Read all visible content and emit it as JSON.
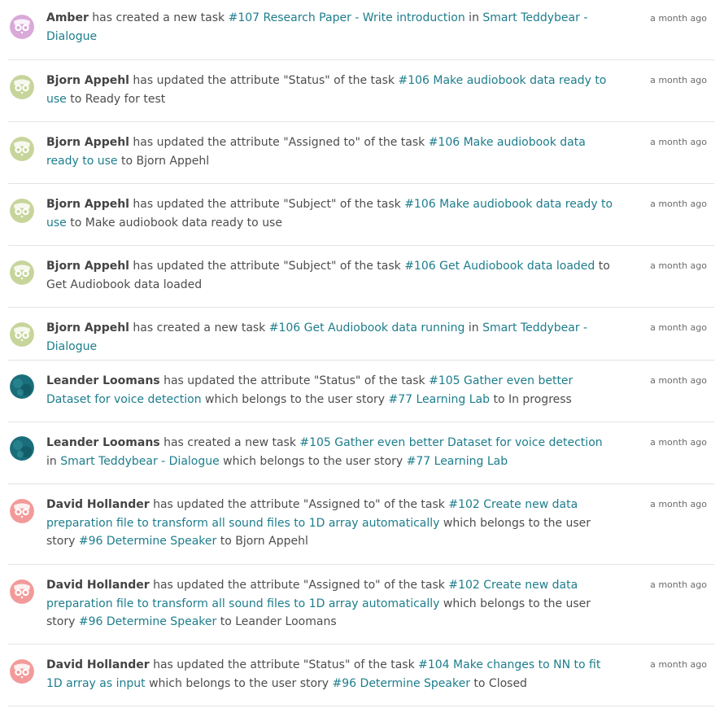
{
  "colors": {
    "link": "#1d7d8c",
    "avatar_amber": "#d9a9d9",
    "avatar_bjorn": "#c7d59b",
    "avatar_leander": "#1a6e7c",
    "avatar_david": "#f29a9a"
  },
  "activities": [
    {
      "user": "Amber",
      "avatar": "owl-avatar-pink",
      "time": "a month ago",
      "segments": [
        {
          "t": " has created a new task ",
          "l": false
        },
        {
          "t": "#107 Research Paper - Write introduction",
          "l": true
        },
        {
          "t": " in ",
          "l": false
        },
        {
          "t": "Smart Teddybear - Dialogue",
          "l": true
        }
      ]
    },
    {
      "user": "Bjorn Appehl",
      "avatar": "owl-avatar-green",
      "time": "a month ago",
      "segments": [
        {
          "t": " has updated the attribute \"Status\" of the task ",
          "l": false
        },
        {
          "t": "#106 Make audiobook data ready to use",
          "l": true
        },
        {
          "t": " to Ready for test",
          "l": false
        }
      ]
    },
    {
      "user": "Bjorn Appehl",
      "avatar": "owl-avatar-green",
      "time": "a month ago",
      "segments": [
        {
          "t": " has updated the attribute \"Assigned to\" of the task ",
          "l": false
        },
        {
          "t": "#106 Make audiobook data ready to use",
          "l": true
        },
        {
          "t": " to Bjorn Appehl",
          "l": false
        }
      ]
    },
    {
      "user": "Bjorn Appehl",
      "avatar": "owl-avatar-green",
      "time": "a month ago",
      "segments": [
        {
          "t": " has updated the attribute \"Subject\" of the task ",
          "l": false
        },
        {
          "t": "#106 Make audiobook data ready to use",
          "l": true
        },
        {
          "t": " to Make audiobook data ready to use",
          "l": false
        }
      ]
    },
    {
      "user": "Bjorn Appehl",
      "avatar": "owl-avatar-green",
      "time": "a month ago",
      "segments": [
        {
          "t": " has updated the attribute \"Subject\" of the task ",
          "l": false
        },
        {
          "t": "#106 Get Audiobook data loaded",
          "l": true
        },
        {
          "t": " to Get Audiobook data loaded",
          "l": false
        }
      ]
    },
    {
      "user": "Bjorn Appehl",
      "avatar": "owl-avatar-green",
      "time": "a month ago",
      "segments": [
        {
          "t": " has created a new task ",
          "l": false
        },
        {
          "t": "#106 Get Audiobook data running",
          "l": true
        },
        {
          "t": " in ",
          "l": false
        },
        {
          "t": "Smart Teddybear - Dialogue",
          "l": true
        }
      ]
    },
    {
      "user": "Leander Loomans",
      "avatar": "photo-avatar-teal",
      "time": "a month ago",
      "segments": [
        {
          "t": " has updated the attribute \"Status\" of the task ",
          "l": false
        },
        {
          "t": "#105 Gather even better Dataset for voice detection",
          "l": true
        },
        {
          "t": " which belongs to the user story ",
          "l": false
        },
        {
          "t": "#77 Learning Lab",
          "l": true
        },
        {
          "t": " to In progress",
          "l": false
        }
      ]
    },
    {
      "user": "Leander Loomans",
      "avatar": "photo-avatar-teal",
      "time": "a month ago",
      "segments": [
        {
          "t": " has created a new task ",
          "l": false
        },
        {
          "t": "#105 Gather even better Dataset for voice detection",
          "l": true
        },
        {
          "t": " in ",
          "l": false
        },
        {
          "t": "Smart Teddybear - Dialogue",
          "l": true
        },
        {
          "t": " which belongs to the user story ",
          "l": false
        },
        {
          "t": "#77 Learning Lab",
          "l": true
        }
      ]
    },
    {
      "user": "David Hollander",
      "avatar": "owl-avatar-red",
      "time": "a month ago",
      "segments": [
        {
          "t": " has updated the attribute \"Assigned to\" of the task ",
          "l": false
        },
        {
          "t": "#102 Create new data preparation file to transform all sound files to 1D array automatically",
          "l": true
        },
        {
          "t": " which belongs to the user story ",
          "l": false
        },
        {
          "t": "#96 Determine Speaker",
          "l": true
        },
        {
          "t": " to Bjorn Appehl",
          "l": false
        }
      ]
    },
    {
      "user": "David Hollander",
      "avatar": "owl-avatar-red",
      "time": "a month ago",
      "segments": [
        {
          "t": " has updated the attribute \"Assigned to\" of the task ",
          "l": false
        },
        {
          "t": "#102 Create new data preparation file to transform all sound files to 1D array automatically",
          "l": true
        },
        {
          "t": " which belongs to the user story ",
          "l": false
        },
        {
          "t": "#96 Determine Speaker",
          "l": true
        },
        {
          "t": " to Leander Loomans",
          "l": false
        }
      ]
    },
    {
      "user": "David Hollander",
      "avatar": "owl-avatar-red",
      "time": "a month ago",
      "segments": [
        {
          "t": " has updated the attribute \"Status\" of the task ",
          "l": false
        },
        {
          "t": "#104 Make changes to NN to fit 1D array as input",
          "l": true
        },
        {
          "t": " which belongs to the user story ",
          "l": false
        },
        {
          "t": "#96 Determine Speaker",
          "l": true
        },
        {
          "t": " to Closed",
          "l": false
        }
      ]
    }
  ]
}
